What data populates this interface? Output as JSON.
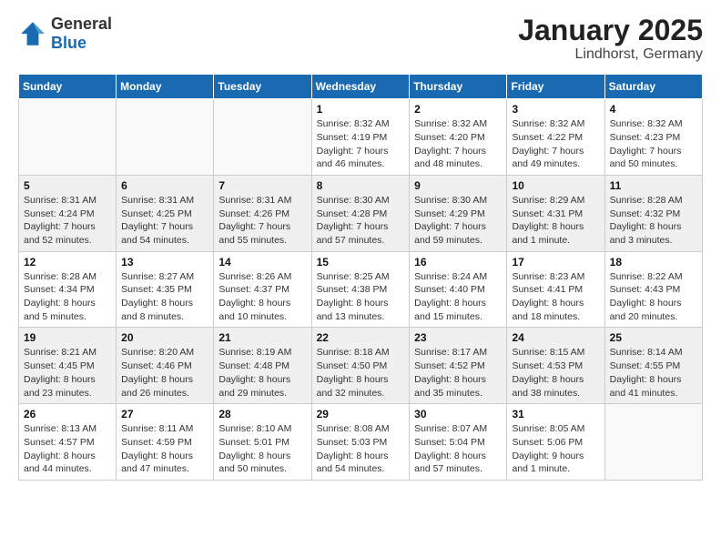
{
  "logo": {
    "general": "General",
    "blue": "Blue"
  },
  "title": {
    "month": "January 2025",
    "location": "Lindhorst, Germany"
  },
  "headers": [
    "Sunday",
    "Monday",
    "Tuesday",
    "Wednesday",
    "Thursday",
    "Friday",
    "Saturday"
  ],
  "weeks": [
    [
      {
        "day": "",
        "info": ""
      },
      {
        "day": "",
        "info": ""
      },
      {
        "day": "",
        "info": ""
      },
      {
        "day": "1",
        "info": "Sunrise: 8:32 AM\nSunset: 4:19 PM\nDaylight: 7 hours and 46 minutes."
      },
      {
        "day": "2",
        "info": "Sunrise: 8:32 AM\nSunset: 4:20 PM\nDaylight: 7 hours and 48 minutes."
      },
      {
        "day": "3",
        "info": "Sunrise: 8:32 AM\nSunset: 4:22 PM\nDaylight: 7 hours and 49 minutes."
      },
      {
        "day": "4",
        "info": "Sunrise: 8:32 AM\nSunset: 4:23 PM\nDaylight: 7 hours and 50 minutes."
      }
    ],
    [
      {
        "day": "5",
        "info": "Sunrise: 8:31 AM\nSunset: 4:24 PM\nDaylight: 7 hours and 52 minutes."
      },
      {
        "day": "6",
        "info": "Sunrise: 8:31 AM\nSunset: 4:25 PM\nDaylight: 7 hours and 54 minutes."
      },
      {
        "day": "7",
        "info": "Sunrise: 8:31 AM\nSunset: 4:26 PM\nDaylight: 7 hours and 55 minutes."
      },
      {
        "day": "8",
        "info": "Sunrise: 8:30 AM\nSunset: 4:28 PM\nDaylight: 7 hours and 57 minutes."
      },
      {
        "day": "9",
        "info": "Sunrise: 8:30 AM\nSunset: 4:29 PM\nDaylight: 7 hours and 59 minutes."
      },
      {
        "day": "10",
        "info": "Sunrise: 8:29 AM\nSunset: 4:31 PM\nDaylight: 8 hours and 1 minute."
      },
      {
        "day": "11",
        "info": "Sunrise: 8:28 AM\nSunset: 4:32 PM\nDaylight: 8 hours and 3 minutes."
      }
    ],
    [
      {
        "day": "12",
        "info": "Sunrise: 8:28 AM\nSunset: 4:34 PM\nDaylight: 8 hours and 5 minutes."
      },
      {
        "day": "13",
        "info": "Sunrise: 8:27 AM\nSunset: 4:35 PM\nDaylight: 8 hours and 8 minutes."
      },
      {
        "day": "14",
        "info": "Sunrise: 8:26 AM\nSunset: 4:37 PM\nDaylight: 8 hours and 10 minutes."
      },
      {
        "day": "15",
        "info": "Sunrise: 8:25 AM\nSunset: 4:38 PM\nDaylight: 8 hours and 13 minutes."
      },
      {
        "day": "16",
        "info": "Sunrise: 8:24 AM\nSunset: 4:40 PM\nDaylight: 8 hours and 15 minutes."
      },
      {
        "day": "17",
        "info": "Sunrise: 8:23 AM\nSunset: 4:41 PM\nDaylight: 8 hours and 18 minutes."
      },
      {
        "day": "18",
        "info": "Sunrise: 8:22 AM\nSunset: 4:43 PM\nDaylight: 8 hours and 20 minutes."
      }
    ],
    [
      {
        "day": "19",
        "info": "Sunrise: 8:21 AM\nSunset: 4:45 PM\nDaylight: 8 hours and 23 minutes."
      },
      {
        "day": "20",
        "info": "Sunrise: 8:20 AM\nSunset: 4:46 PM\nDaylight: 8 hours and 26 minutes."
      },
      {
        "day": "21",
        "info": "Sunrise: 8:19 AM\nSunset: 4:48 PM\nDaylight: 8 hours and 29 minutes."
      },
      {
        "day": "22",
        "info": "Sunrise: 8:18 AM\nSunset: 4:50 PM\nDaylight: 8 hours and 32 minutes."
      },
      {
        "day": "23",
        "info": "Sunrise: 8:17 AM\nSunset: 4:52 PM\nDaylight: 8 hours and 35 minutes."
      },
      {
        "day": "24",
        "info": "Sunrise: 8:15 AM\nSunset: 4:53 PM\nDaylight: 8 hours and 38 minutes."
      },
      {
        "day": "25",
        "info": "Sunrise: 8:14 AM\nSunset: 4:55 PM\nDaylight: 8 hours and 41 minutes."
      }
    ],
    [
      {
        "day": "26",
        "info": "Sunrise: 8:13 AM\nSunset: 4:57 PM\nDaylight: 8 hours and 44 minutes."
      },
      {
        "day": "27",
        "info": "Sunrise: 8:11 AM\nSunset: 4:59 PM\nDaylight: 8 hours and 47 minutes."
      },
      {
        "day": "28",
        "info": "Sunrise: 8:10 AM\nSunset: 5:01 PM\nDaylight: 8 hours and 50 minutes."
      },
      {
        "day": "29",
        "info": "Sunrise: 8:08 AM\nSunset: 5:03 PM\nDaylight: 8 hours and 54 minutes."
      },
      {
        "day": "30",
        "info": "Sunrise: 8:07 AM\nSunset: 5:04 PM\nDaylight: 8 hours and 57 minutes."
      },
      {
        "day": "31",
        "info": "Sunrise: 8:05 AM\nSunset: 5:06 PM\nDaylight: 9 hours and 1 minute."
      },
      {
        "day": "",
        "info": ""
      }
    ]
  ]
}
